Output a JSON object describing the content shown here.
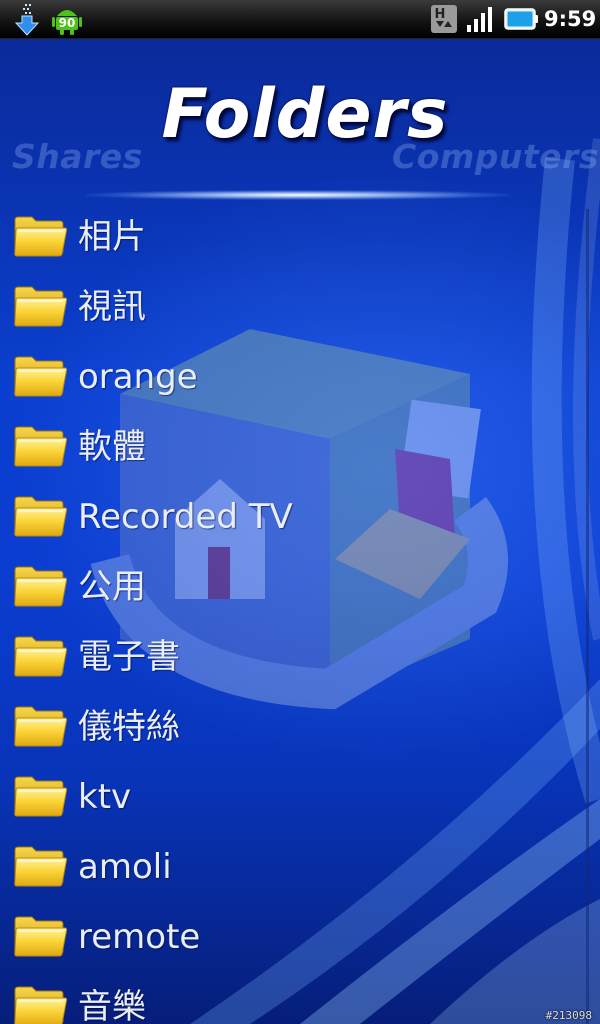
{
  "status_bar": {
    "time": "9:59",
    "android_badge": "90",
    "network_icon_label": "H",
    "icons": [
      "download-icon",
      "android-notification-icon",
      "hsdpa-icon",
      "signal-icon",
      "battery-icon"
    ]
  },
  "header": {
    "title": "Folders",
    "left_tab": "Shares",
    "right_tab": "Computers"
  },
  "folders": [
    {
      "label": "相片"
    },
    {
      "label": "視訊"
    },
    {
      "label": "orange"
    },
    {
      "label": "軟體"
    },
    {
      "label": "Recorded TV"
    },
    {
      "label": "公用"
    },
    {
      "label": "電子書"
    },
    {
      "label": "儀特絲"
    },
    {
      "label": "ktv"
    },
    {
      "label": "amoli"
    },
    {
      "label": "remote"
    },
    {
      "label": "音樂"
    }
  ],
  "watermark": "#213098",
  "colors": {
    "background_blue": "#0b3dd0",
    "folder_yellow": "#f5c718",
    "text": "#e9edf6"
  }
}
